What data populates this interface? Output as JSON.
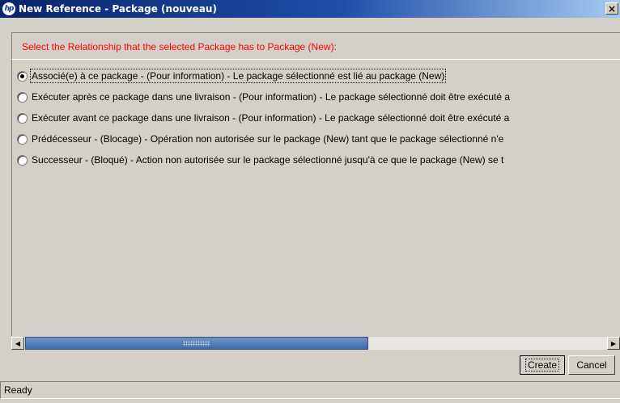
{
  "window": {
    "title": "New Reference - Package (nouveau)",
    "close_glyph": "×"
  },
  "instruction": "Select the Relationship that the selected Package has to Package (New):",
  "options": [
    {
      "label": "Associé(e) à ce package - (Pour information) - Le package sélectionné est lié au package (New)",
      "checked": true
    },
    {
      "label": "Exécuter après ce package dans une livraison - (Pour information) - Le package sélectionné doit être exécuté a",
      "checked": false
    },
    {
      "label": "Exécuter avant ce package dans une livraison - (Pour information) - Le package sélectionné doit être exécuté a",
      "checked": false
    },
    {
      "label": "Prédécesseur - (Blocage) - Opération non autorisée sur le package (New) tant que le package sélectionné n'e",
      "checked": false
    },
    {
      "label": "Successeur - (Bloqué) - Action non autorisée sur le package sélectionné jusqu'à ce que le package (New) se t",
      "checked": false
    }
  ],
  "scrollbar": {
    "left_glyph": "◀",
    "right_glyph": "▶",
    "position_fraction": 0.0
  },
  "buttons": {
    "create": "Create",
    "cancel": "Cancel"
  },
  "status": "Ready",
  "colors": {
    "instruction": "#ff0000",
    "titlebar_start": "#0a246a",
    "titlebar_end": "#a6caf0"
  }
}
